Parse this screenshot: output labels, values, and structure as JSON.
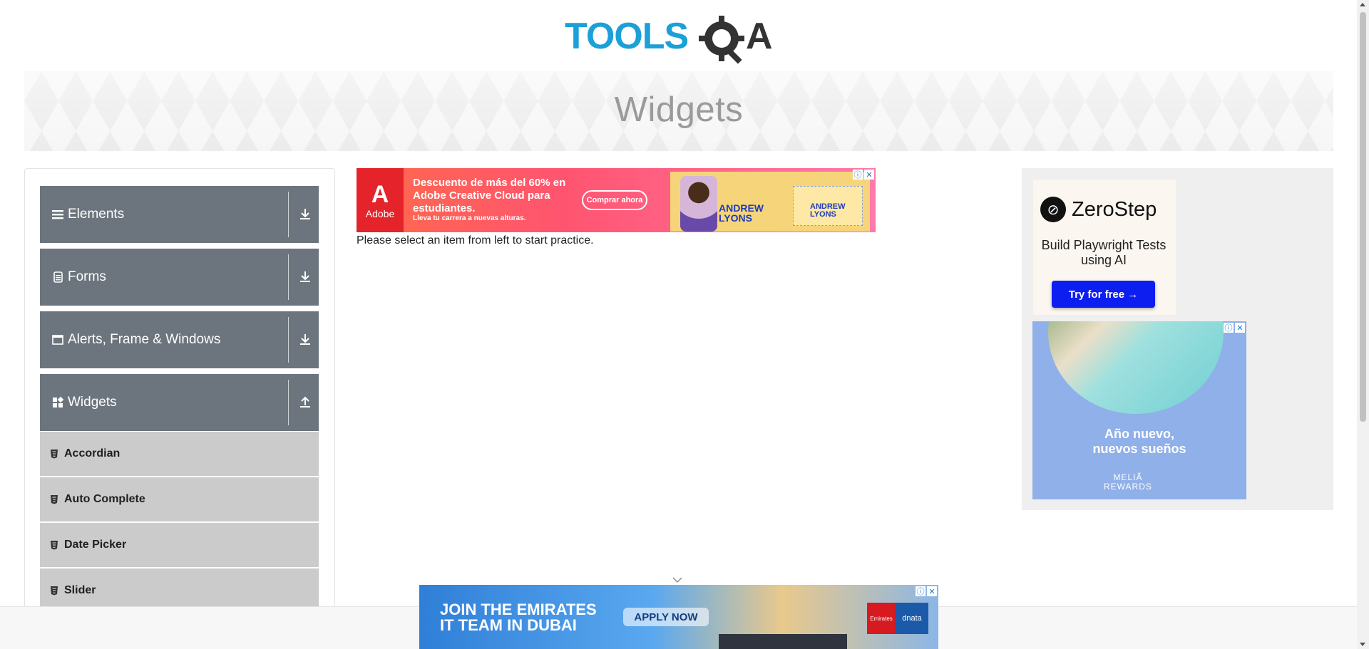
{
  "logo": {
    "text": "TOOLSQA",
    "colors": {
      "tools": "#1ba0d8",
      "qa": "#333333"
    }
  },
  "banner": {
    "title": "Widgets"
  },
  "sidebar": {
    "groups": [
      {
        "label": "Elements",
        "icon": "hamburger-icon",
        "arrow": "download-arrow-icon"
      },
      {
        "label": "Forms",
        "icon": "document-icon",
        "arrow": "download-arrow-icon"
      },
      {
        "label": "Alerts, Frame & Windows",
        "icon": "window-icon",
        "arrow": "download-arrow-icon"
      },
      {
        "label": "Widgets",
        "icon": "widgets-grid-icon",
        "arrow": "upload-arrow-icon",
        "expanded": true
      }
    ],
    "widget_items": [
      {
        "label": "Accordian",
        "icon": "html5-icon"
      },
      {
        "label": "Auto Complete",
        "icon": "html5-icon"
      },
      {
        "label": "Date Picker",
        "icon": "html5-icon"
      },
      {
        "label": "Slider",
        "icon": "html5-icon"
      }
    ]
  },
  "main": {
    "instruction": "Please select an item from left to start practice."
  },
  "ads": {
    "top": {
      "brand": "Adobe",
      "headline": "Descuento de más del 60% en Adobe Creative Cloud para estudiantes.",
      "subline": "Lleva tu carrera a nuevas alturas.",
      "cta": "Comprar ahora",
      "name_first": "ANDREW",
      "name_last": "LYONS"
    },
    "right": {
      "brand": "ZeroStep",
      "subtitle": "Build Playwright Tests using AI",
      "cta": "Try for free →",
      "melia_line1": "Año nuevo,",
      "melia_line2": "nuevos sueños",
      "melia_brand1": "MELIÃ",
      "melia_brand2": "REWARDS"
    },
    "bottom": {
      "line1": "JOIN THE EMIRATES",
      "line2": "IT TEAM IN DUBAI",
      "cta": "APPLY NOW",
      "logo_emirates": "Emirates",
      "logo_dnata": "dnata"
    }
  }
}
